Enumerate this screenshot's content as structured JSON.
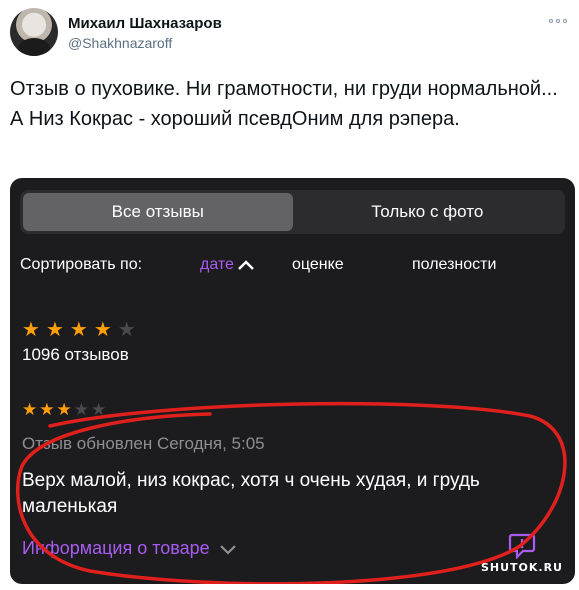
{
  "tweet": {
    "author_name": "Михаил Шахназаров",
    "author_handle": "@Shakhnazaroff",
    "more_icon": "more-horizontal-icon",
    "text": "Отзыв о пуховике. Ни грамотности, ни груди нормальной... А Низ Кокрас - хороший псевдОним для рэпера."
  },
  "screenshot": {
    "tabs": [
      {
        "label": "Все отзывы",
        "active": true
      },
      {
        "label": "Только с фото",
        "active": false
      }
    ],
    "sort": {
      "label": "Сортировать по:",
      "options": [
        "дате",
        "оценке",
        "полезности"
      ],
      "selected": "дате"
    },
    "summary": {
      "rating": 4,
      "max_rating": 5,
      "count_text": "1096 отзывов"
    },
    "review": {
      "rating": 3,
      "max_rating": 5,
      "date_text": "Отзыв обновлен Сегодня, 5:05",
      "body": "Верх малой, низ кокрас,  хотя ч очень худая, и грудь маленькая",
      "product_info_label": "Информация о товаре"
    },
    "colors": {
      "accent": "#a95cf2",
      "star": "#ff9f0a",
      "background": "#1c1c1e",
      "annotation": "#e0201c"
    }
  },
  "watermark": "SHUTOK.RU"
}
